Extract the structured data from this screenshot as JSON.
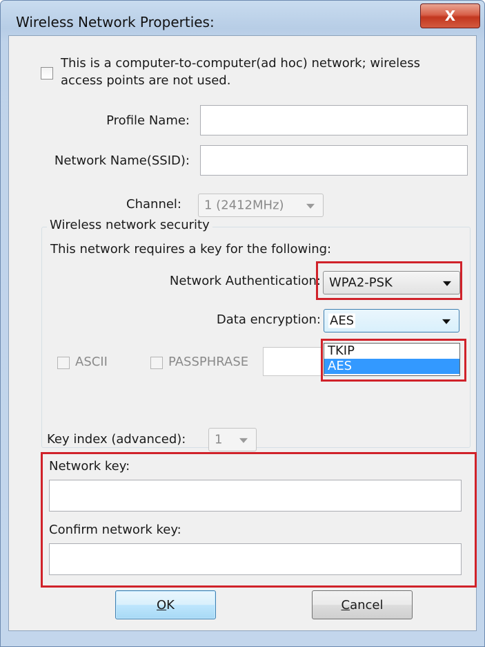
{
  "window": {
    "title": "Wireless Network Properties:",
    "close_label": "X"
  },
  "adhoc": {
    "label_line1": "This is a computer-to-computer(ad hoc) network; wireless",
    "label_line2": "access points are not used.",
    "checked": false
  },
  "profile": {
    "label": "Profile Name:",
    "value": ""
  },
  "ssid": {
    "label": "Network Name(SSID):",
    "value": ""
  },
  "channel": {
    "label": "Channel:",
    "value": "1  (2412MHz)"
  },
  "security": {
    "group_label": "Wireless network security",
    "requires_text": "This network requires a key for the following:",
    "auth_label": "Network Authentication:",
    "auth_value": "WPA2-PSK",
    "enc_label": "Data encryption:",
    "enc_value": "AES",
    "enc_options": [
      "TKIP",
      "AES"
    ],
    "ascii_label": "ASCII",
    "passphrase_label": "PASSPHRASE"
  },
  "key_index": {
    "label": "Key index (advanced):",
    "value": "1"
  },
  "network_key": {
    "label": "Network key:",
    "value": ""
  },
  "confirm_key": {
    "label": "Confirm network key:",
    "value": ""
  },
  "buttons": {
    "ok_prefix": "",
    "ok_mnemonic": "O",
    "ok_rest": "K",
    "cancel_mnemonic": "C",
    "cancel_rest": "ancel"
  },
  "highlight_color": "#d0222a"
}
